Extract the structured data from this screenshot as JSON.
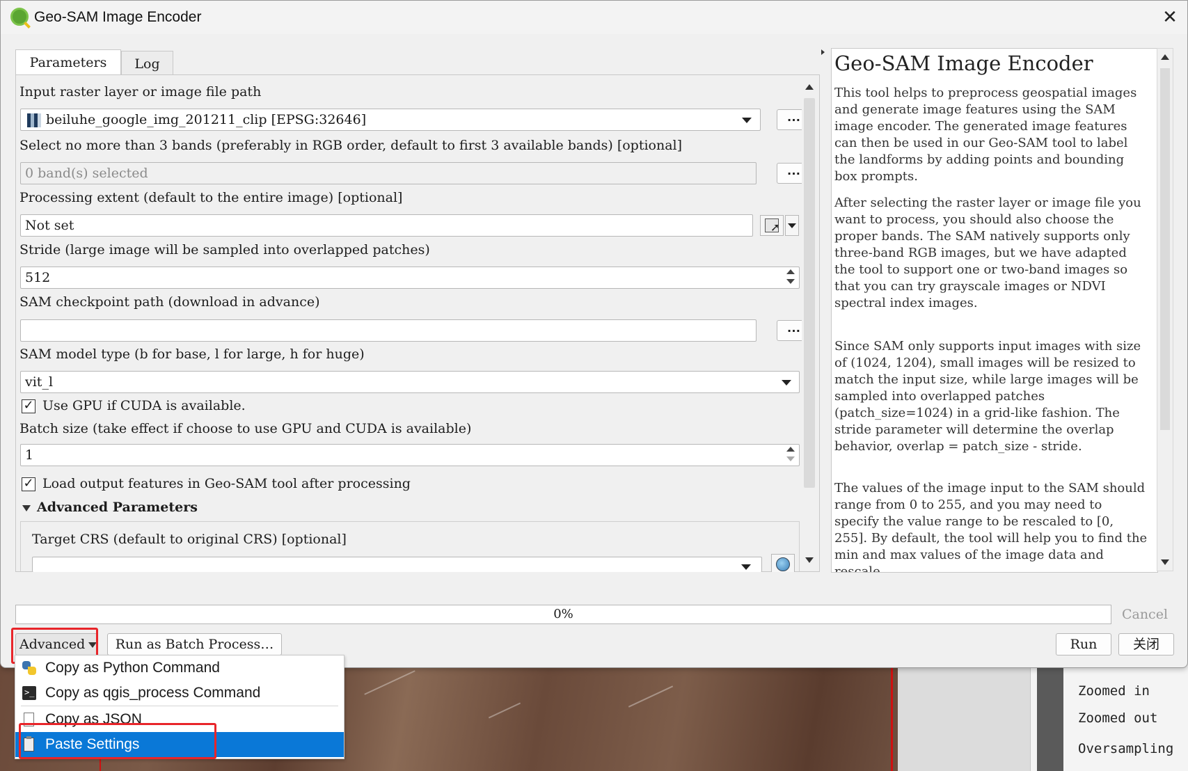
{
  "window": {
    "title": "Geo-SAM Image Encoder",
    "close_glyph": "✕"
  },
  "tabs": [
    {
      "label": "Parameters"
    },
    {
      "label": "Log"
    }
  ],
  "params": {
    "input_label": "Input raster layer or image file path",
    "input_value": "beiluhe_google_img_201211_clip [EPSG:32646]",
    "bands_label": "Select no more than 3 bands (preferably in RGB order, default to first 3 available bands) [optional]",
    "bands_value": "0 band(s) selected",
    "extent_label": "Processing extent (default to the entire image) [optional]",
    "extent_value": "Not set",
    "stride_label": "Stride (large image will be sampled into overlapped patches)",
    "stride_value": "512",
    "checkpoint_label": "SAM checkpoint path (download in advance)",
    "checkpoint_value": "",
    "model_label": "SAM model type (b for base, l for large, h for huge)",
    "model_value": "vit_l",
    "gpu_label": "Use GPU if CUDA is available.",
    "gpu_checked": true,
    "batch_label": "Batch size (take effect if choose to use GPU and CUDA is available)",
    "batch_value": "1",
    "load_label": "Load output features in Geo-SAM tool after processing",
    "load_checked": true,
    "advanced_header": "Advanced Parameters",
    "crs_label": "Target CRS (default to original CRS) [optional]",
    "browse_glyph": "…",
    "check_glyph": "✓"
  },
  "help": {
    "title": "Geo-SAM Image Encoder",
    "paragraphs": [
      "This tool helps to preprocess geospatial images and generate image features using the SAM image encoder. The generated image features can then be used in our Geo-SAM tool to label the landforms by adding points and bounding box prompts.",
      "After selecting the raster layer or image file you want to process, you should also choose the proper bands. The SAM natively supports only three-band RGB images, but we have adapted the tool to support one or two-band images so that you can try grayscale images or NDVI spectral index images.",
      "Since SAM only supports input images with size of (1024, 1204), small images will be resized to match the input size, while large images will be sampled into overlapped patches (patch_size=1024) in a grid-like fashion. The stride parameter will determine the overlap behavior, overlap = patch_size - stride.",
      "The values of the image input to the SAM should range from 0 to 255, and you may need to specify the value range to be rescaled to [0, 255]. By default, the tool will help you to find the min and max values of the image data and rescale"
    ]
  },
  "progress": {
    "text": "0%",
    "cancel_label": "Cancel"
  },
  "buttons": {
    "advanced": "Advanced",
    "batch": "Run as Batch Process…",
    "run": "Run",
    "close": "关闭"
  },
  "menu": {
    "items": [
      {
        "label": "Copy as Python Command",
        "icon": "python-icon"
      },
      {
        "label": "Copy as qgis_process Command",
        "icon": "terminal-icon"
      },
      {
        "label": "Copy as JSON",
        "icon": "document-icon"
      },
      {
        "label": "Paste Settings",
        "icon": "clipboard-icon",
        "selected": true
      }
    ]
  },
  "background": {
    "items": [
      "Zoomed in",
      "Zoomed out",
      "Oversampling"
    ]
  },
  "colors": {
    "accent": "#0a78d7",
    "highlight": "#e8252a"
  }
}
